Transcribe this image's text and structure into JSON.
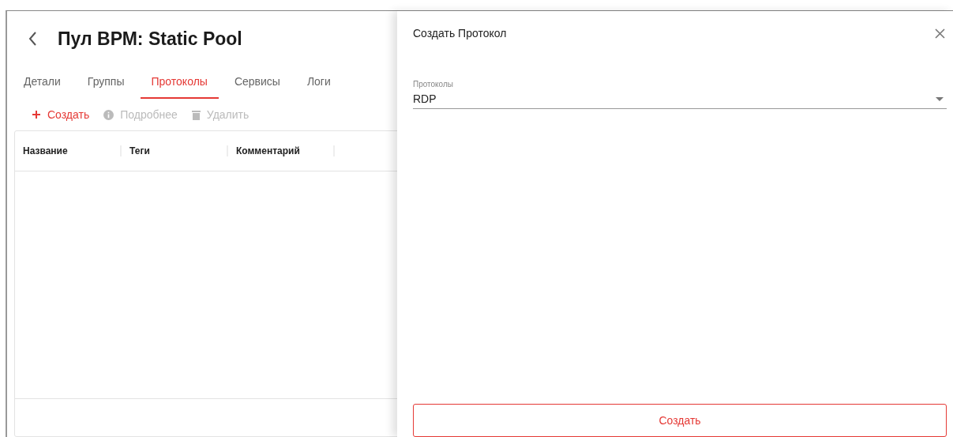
{
  "page": {
    "title": "Пул ВРМ: Static Pool"
  },
  "tabs": [
    {
      "label": "Детали",
      "selected": false
    },
    {
      "label": "Группы",
      "selected": false
    },
    {
      "label": "Протоколы",
      "selected": true
    },
    {
      "label": "Сервисы",
      "selected": false
    },
    {
      "label": "Логи",
      "selected": false
    }
  ],
  "actions": [
    {
      "kind": "add",
      "label": "Создать",
      "disabled": false
    },
    {
      "kind": "info",
      "label": "Подробнее",
      "disabled": true
    },
    {
      "kind": "delete",
      "label": "Удалить",
      "disabled": true
    }
  ],
  "table": {
    "columns": [
      "Название",
      "Теги",
      "Комментарий"
    ]
  },
  "drawer": {
    "title": "Создать Протокол",
    "field": {
      "label": "Протоколы",
      "value": "RDP"
    },
    "submit": "Создать"
  }
}
